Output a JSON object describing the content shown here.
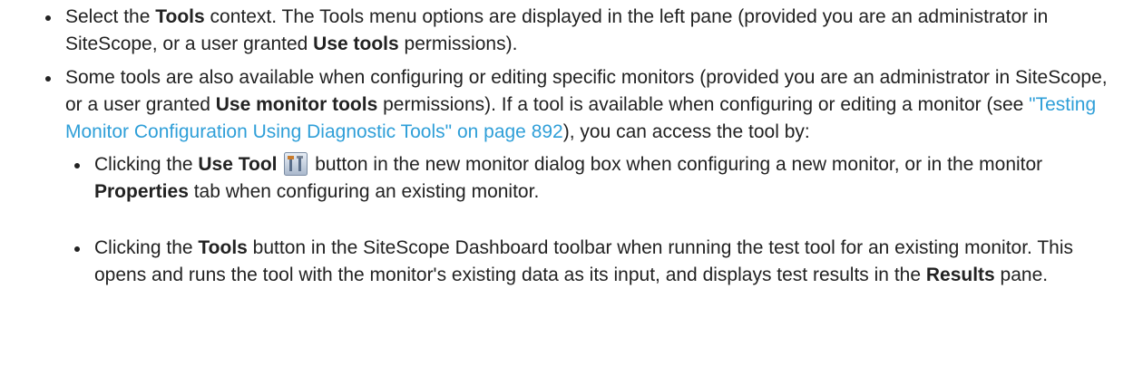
{
  "bullets": [
    {
      "pre": "Select the ",
      "bold1": "Tools",
      "mid": " context. The Tools menu options are displayed in the left pane (provided you are an administrator in SiteScope, or a user granted ",
      "bold2": "Use tools",
      "post": " permissions)."
    },
    {
      "pre": "Some tools are also available when configuring or editing specific monitors (provided you are an administrator in SiteScope, or a user granted ",
      "bold1": "Use monitor tools",
      "mid": " permissions). If a tool is available when configuring or editing a monitor (see ",
      "link": "\"Testing Monitor Configuration Using Diagnostic Tools\" on page 892",
      "post": "), you can access the tool by:"
    }
  ],
  "sub_bullets": [
    {
      "pre": "Clicking the ",
      "bold1": "Use Tool",
      "icon": "use-tool-icon",
      "mid": " button in the new monitor dialog box when configuring a new monitor, or in the monitor ",
      "bold2": "Properties",
      "post": " tab when configuring an existing monitor."
    },
    {
      "pre": "Clicking the ",
      "bold1": "Tools",
      "mid": "  button in the SiteScope Dashboard toolbar when running the test tool for an existing monitor. This opens and runs the tool with the monitor's existing data as its input, and displays test results in the ",
      "bold2": "Results",
      "post": " pane."
    }
  ]
}
